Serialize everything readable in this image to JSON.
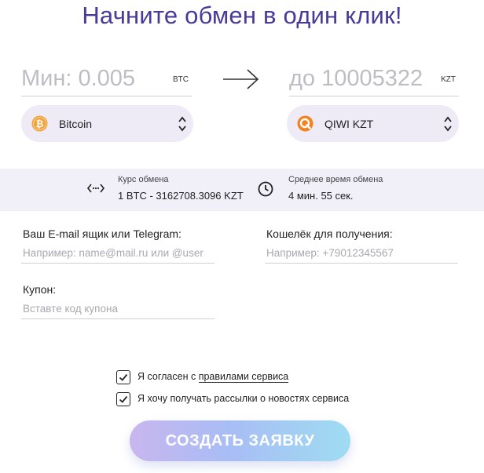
{
  "title": "Начните обмен в один клик!",
  "exchange": {
    "from": {
      "placeholder": "Мин: 0.005",
      "currency": "BTC",
      "select_label": "Bitcoin",
      "coin_icon": "bitcoin-icon",
      "coin_color": "#f2a33a"
    },
    "to": {
      "placeholder": "до 10005322",
      "currency": "KZT",
      "select_label": "QIWI KZT",
      "coin_icon": "qiwi-icon",
      "coin_color": "#f58220"
    }
  },
  "rate": {
    "caption": "Курс обмена",
    "value": "1 BTC - 3162708.3096 KZT",
    "time_caption": "Среднее время обмена",
    "time_value": "4 мин. 55 сек."
  },
  "form": {
    "contact_label": "Ваш E-mail ящик или Telegram:",
    "contact_placeholder": "Например: name@mail.ru или @user",
    "wallet_label": "Кошелёк для получения:",
    "wallet_placeholder": "Например: +79012345567",
    "coupon_label": "Купон:",
    "coupon_placeholder": "Вставте код купона"
  },
  "agreements": {
    "terms_prefix": "Я согласен с ",
    "terms_link": "правилами сервиса",
    "terms_checked": true,
    "newsletter": "Я хочу получать рассылки о новостях сервиса",
    "newsletter_checked": true
  },
  "submit_label": "СОЗДАТЬ ЗАЯВКУ",
  "colors": {
    "title": "#4a3a98",
    "select_bg": "#eeebf6",
    "rate_bg": "#f1eff7"
  }
}
